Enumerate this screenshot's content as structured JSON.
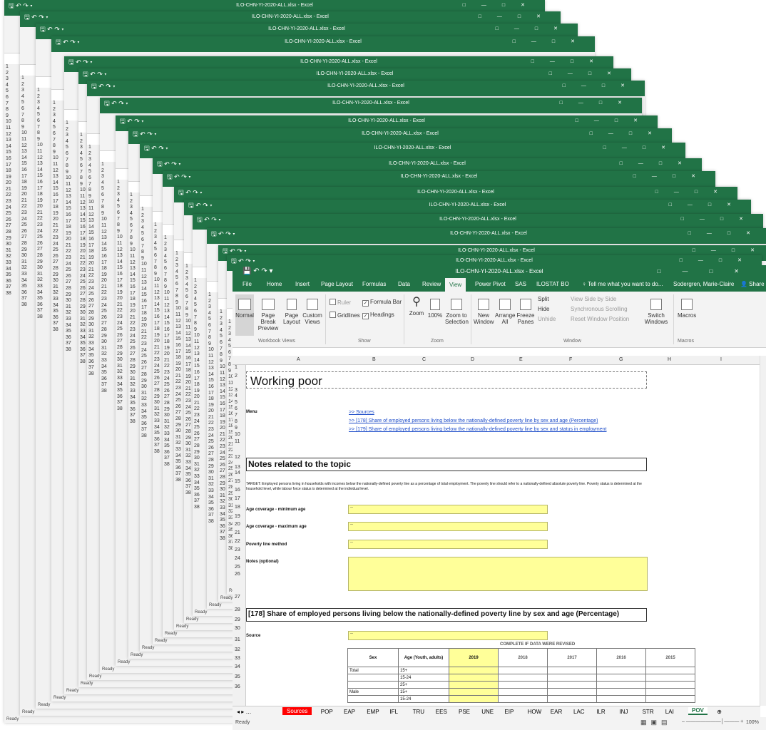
{
  "window": {
    "title": "ILO-CHN-YI-2020-ALL.xlsx - Excel",
    "window_controls": [
      "restore-icon",
      "minimize-icon",
      "maximize-icon",
      "close-icon"
    ]
  },
  "ribbon_tabs": [
    "File",
    "Home",
    "Insert",
    "Page Layout",
    "Formulas",
    "Data",
    "Review",
    "View",
    "Power Pivot",
    "SAS",
    "ILOSTAT BO"
  ],
  "active_tab": "View",
  "tell_me": "Tell me what you want to do...",
  "user": "Sodergren, Marie-Claire",
  "share": "Share",
  "ribbon": {
    "normal": "Normal",
    "page_break": "Page Break Preview",
    "page_layout": "Page Layout",
    "custom_views": "Custom Views",
    "workbook_views": "Workbook Views",
    "ruler": "Ruler",
    "formula_bar": "Formula Bar",
    "gridlines": "Gridlines",
    "headings": "Headings",
    "show": "Show",
    "zoom": "Zoom",
    "zoom100": "100%",
    "zoom_sel": "Zoom to Selection",
    "zoom_group": "Zoom",
    "new_window": "New Window",
    "arrange_all": "Arrange All",
    "freeze_panes": "Freeze Panes",
    "split": "Split",
    "hide": "Hide",
    "unhide": "Unhide",
    "side_by_side": "View Side by Side",
    "sync_scroll": "Synchronous Scrolling",
    "reset_pos": "Reset Window Position",
    "switch_windows": "Switch Windows",
    "window_group": "Window",
    "macros": "Macros",
    "macros_group": "Macros"
  },
  "columns": [
    "A",
    "B",
    "C",
    "D",
    "E",
    "F",
    "G",
    "H",
    "I"
  ],
  "rows": [
    "1",
    "2",
    "3",
    "4",
    "5",
    "6",
    "7",
    "8",
    "9",
    "10",
    "11",
    "12",
    "13",
    "14",
    "15",
    "16",
    "17",
    "18",
    "19",
    "20",
    "21",
    "22",
    "23",
    "24",
    "25",
    "26",
    "27",
    "28",
    "29",
    "30",
    "31",
    "32",
    "33",
    "34",
    "35",
    "36"
  ],
  "sheet": {
    "title": "Working poor",
    "menu_label": "Menu",
    "links": [
      ">> Sources",
      ">> [178]    Share of employed persons living below the nationally-defined poverty line by sex and age (Percentage)",
      ">> [179]    Share of employed persons living below the nationally-defined poverty line by sex and status in employment"
    ],
    "notes_header": "Notes related to the topic",
    "target_text": "TARGET: Employed persons living in households with incomes below the nationally-defined poverty line as a percentage of total employment. The poverty line should refer to a nationally-defined absolute poverty line. Poverty status is determined at the household level, while labour force status is determined at the individual level.",
    "age_min": "Age coverage - minimum age",
    "age_max": "Age coverage - maximum age",
    "poverty_method": "Poverty line method",
    "notes_optional": "Notes (optional)",
    "dash": "--",
    "section178": "[178]    Share of employed persons living below the nationally-defined poverty line by sex and age (Percentage)",
    "source_label": "Source",
    "complete_note": "COMPLETE IF DATA WERE REVISED",
    "table_headers": [
      "Sex",
      "Age (Youth, adults)",
      "2019",
      "2018",
      "2017",
      "2016",
      "2015"
    ],
    "table_rows": [
      [
        "Total",
        "15+"
      ],
      [
        "",
        "15-24"
      ],
      [
        "",
        "25+"
      ],
      [
        "Male",
        "15+"
      ],
      [
        "",
        "15-24"
      ]
    ]
  },
  "sheet_tabs": [
    "Sources",
    "POP",
    "EAP",
    "EMP",
    "IFL",
    "TRU",
    "EES",
    "PSE",
    "UNE",
    "EIP",
    "HOW",
    "EAR",
    "LAC",
    "ILR",
    "INJ",
    "STR",
    "LAI",
    "POV"
  ],
  "active_sheet": "POV",
  "status": "Ready",
  "zoom_level": "100%",
  "stack_ready": "Ready",
  "stack_row_labels": [
    "1",
    "2",
    "3",
    "4",
    "5",
    "6",
    "7",
    "8",
    "9",
    "10",
    "11",
    "12",
    "13",
    "14",
    "15",
    "16",
    "17",
    "18",
    "19",
    "20",
    "21",
    "22",
    "23",
    "24",
    "25",
    "26",
    "27",
    "28",
    "29",
    "30",
    "31",
    "32",
    "33",
    "34",
    "35",
    "36",
    "37",
    "38"
  ]
}
